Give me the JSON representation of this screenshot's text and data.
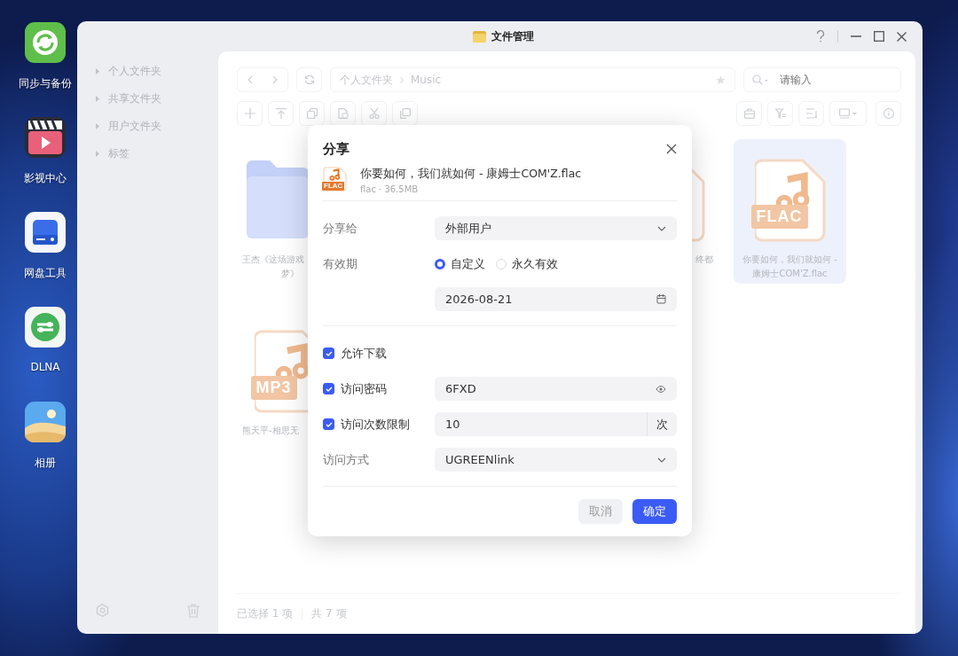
{
  "desktop": {
    "icons": [
      {
        "kind": "sync",
        "label": "同步与备份"
      },
      {
        "kind": "video",
        "label": "影视中心"
      },
      {
        "kind": "disk",
        "label": "网盘工具"
      },
      {
        "kind": "dlna",
        "label": "DLNA"
      },
      {
        "kind": "photos",
        "label": "相册"
      }
    ]
  },
  "window": {
    "title": "文件管理"
  },
  "sidebar": {
    "items": [
      {
        "label": "个人文件夹"
      },
      {
        "label": "共享文件夹"
      },
      {
        "label": "用户文件夹"
      },
      {
        "label": "标签"
      }
    ]
  },
  "toolbar": {
    "breadcrumb": [
      "个人文件夹",
      "Music"
    ],
    "search": {
      "placeholder": "请输入"
    }
  },
  "files": [
    {
      "kind": "folder",
      "selected": false,
      "label_lines": [
        "王杰《这场游戏",
        "梦》"
      ]
    },
    {
      "kind": "audio",
      "selected": false,
      "label_lines": [
        "终都"
      ]
    },
    {
      "kind": "flac",
      "badge": "FLAC",
      "selected": true,
      "label_lines": [
        "你要如何，我们就如何 -",
        "康姆士COM'Z.flac"
      ]
    },
    {
      "kind": "mp3",
      "badge": "MP3",
      "selected": false,
      "label_lines": [
        "熊天平-相思无"
      ]
    }
  ],
  "status_bar": {
    "selected": "已选择 1 项",
    "total": "共 7 项"
  },
  "dialog": {
    "title": "分享",
    "file": {
      "badge": "FLAC",
      "name": "你要如何，我们就如何 - 康姆士COM'Z.flac",
      "meta": "flac · 36.5MB"
    },
    "sections": [
      {
        "rows": [
          {
            "kind": "select",
            "label": "分享给",
            "value": "外部用户"
          },
          {
            "kind": "radio",
            "label": "有效期",
            "options": [
              {
                "label": "自定义",
                "selected": true
              },
              {
                "label": "永久有效",
                "selected": false
              }
            ]
          },
          {
            "kind": "date",
            "value": "2026-08-21"
          }
        ]
      },
      {
        "rows": [
          {
            "kind": "checkbox",
            "label": "允许下载",
            "checked": true
          },
          {
            "kind": "password",
            "label": "访问密码",
            "checked": true,
            "value": "6FXD"
          },
          {
            "kind": "count",
            "label": "访问次数限制",
            "checked": true,
            "value": "10",
            "unit": "次"
          },
          {
            "kind": "select",
            "label": "访问方式",
            "value": "UGREENlink"
          }
        ]
      }
    ],
    "buttons": [
      {
        "kind": "secondary",
        "label": "取消"
      },
      {
        "kind": "primary",
        "label": "确定"
      }
    ]
  }
}
